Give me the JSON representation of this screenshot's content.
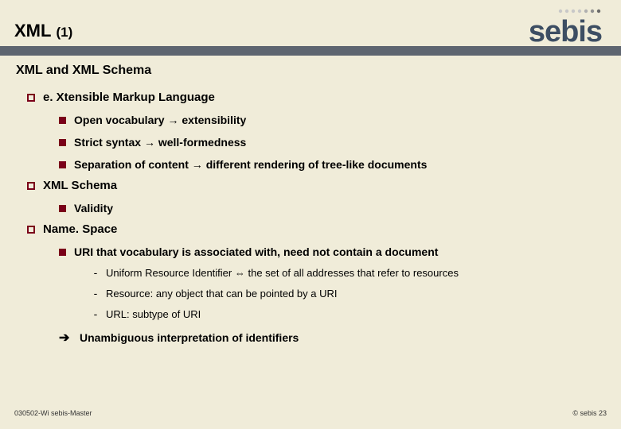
{
  "header": {
    "title_main": "XML",
    "title_sub": "(1)",
    "logo_text": "sebis"
  },
  "section_title": "XML and XML Schema",
  "items": {
    "extensible": {
      "label": "e. Xtensible Markup Language",
      "open_vocab_pre": "Open vocabulary",
      "open_vocab_post": "extensibility",
      "strict_pre": "Strict syntax",
      "strict_post": "well-formedness",
      "separation_pre": "Separation of content",
      "separation_post": "different rendering of tree-like documents"
    },
    "schema": {
      "label": "XML Schema",
      "validity": "Validity"
    },
    "namespace": {
      "label": "Name. Space",
      "uri_label": "URI that vocabulary is associated with, need not contain a document",
      "uri_def_pre": "Uniform Resource Identifier",
      "uri_def_post": "the set of all addresses that refer to resources",
      "resource_def": "Resource: any object that can be pointed by a URI",
      "url_def": "URL: subtype of URI",
      "conclusion": "Unambiguous interpretation of identifiers"
    }
  },
  "glyphs": {
    "right_arrow": "→",
    "double_arrow": "⇔",
    "big_right": "➔",
    "dash": "-"
  },
  "footer": {
    "left": "030502-Wi sebis-Master",
    "right": "© sebis  23"
  }
}
